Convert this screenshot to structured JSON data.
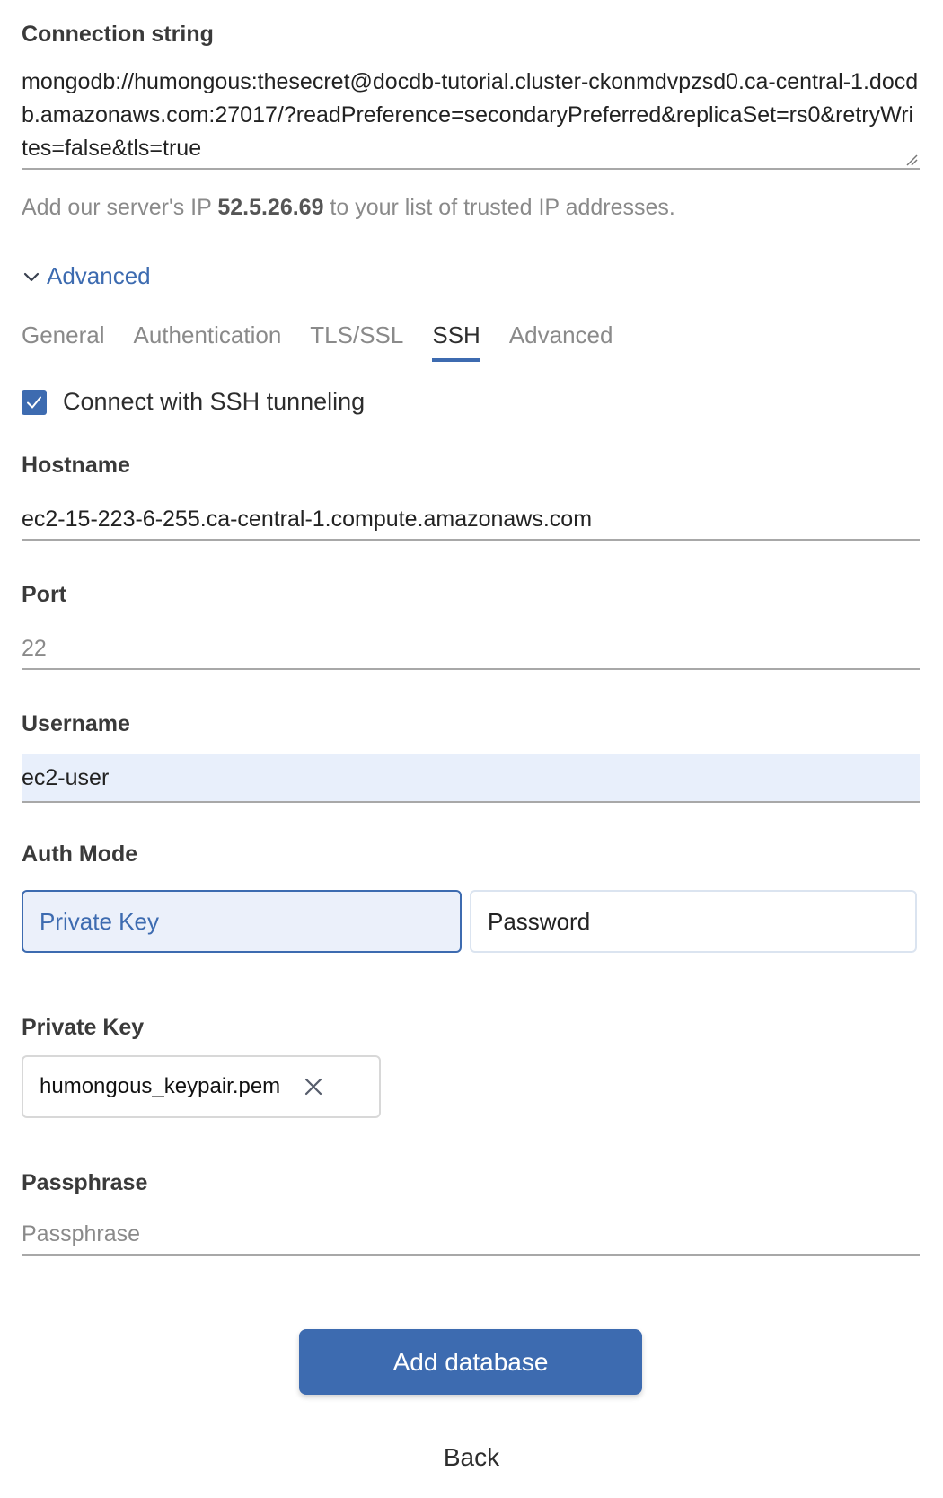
{
  "connection": {
    "label": "Connection string",
    "value": "mongodb://humongous:thesecret@docdb-tutorial.cluster-ckonmdvpzsd0.ca-central-1.docdb.amazonaws.com:27017/?readPreference=secondaryPreferred&replicaSet=rs0&retryWrites=false&tls=true",
    "hint_prefix": "Add our server's IP ",
    "server_ip": "52.5.26.69",
    "hint_suffix": " to your list of trusted IP addresses."
  },
  "advanced_toggle": {
    "label": "Advanced",
    "icon": "chevron-down-icon",
    "expanded": true
  },
  "tabs": [
    {
      "label": "General",
      "active": false
    },
    {
      "label": "Authentication",
      "active": false
    },
    {
      "label": "TLS/SSL",
      "active": false
    },
    {
      "label": "SSH",
      "active": true
    },
    {
      "label": "Advanced",
      "active": false
    }
  ],
  "ssh": {
    "checkbox_label": "Connect with SSH tunneling",
    "checkbox_checked": true,
    "hostname": {
      "label": "Hostname",
      "value": "ec2-15-223-6-255.ca-central-1.compute.amazonaws.com"
    },
    "port": {
      "label": "Port",
      "placeholder": "22",
      "value": ""
    },
    "username": {
      "label": "Username",
      "value": "ec2-user"
    },
    "auth_mode": {
      "label": "Auth Mode",
      "options": [
        "Private Key",
        "Password"
      ],
      "selected": "Private Key"
    },
    "private_key": {
      "label": "Private Key",
      "file_name": "humongous_keypair.pem"
    },
    "passphrase": {
      "label": "Passphrase",
      "placeholder": "Passphrase",
      "value": ""
    }
  },
  "actions": {
    "primary": "Add database",
    "back": "Back"
  },
  "colors": {
    "accent": "#3d6bb0",
    "filled_input_bg": "#e8effb",
    "muted_text": "#8a8a8a"
  }
}
